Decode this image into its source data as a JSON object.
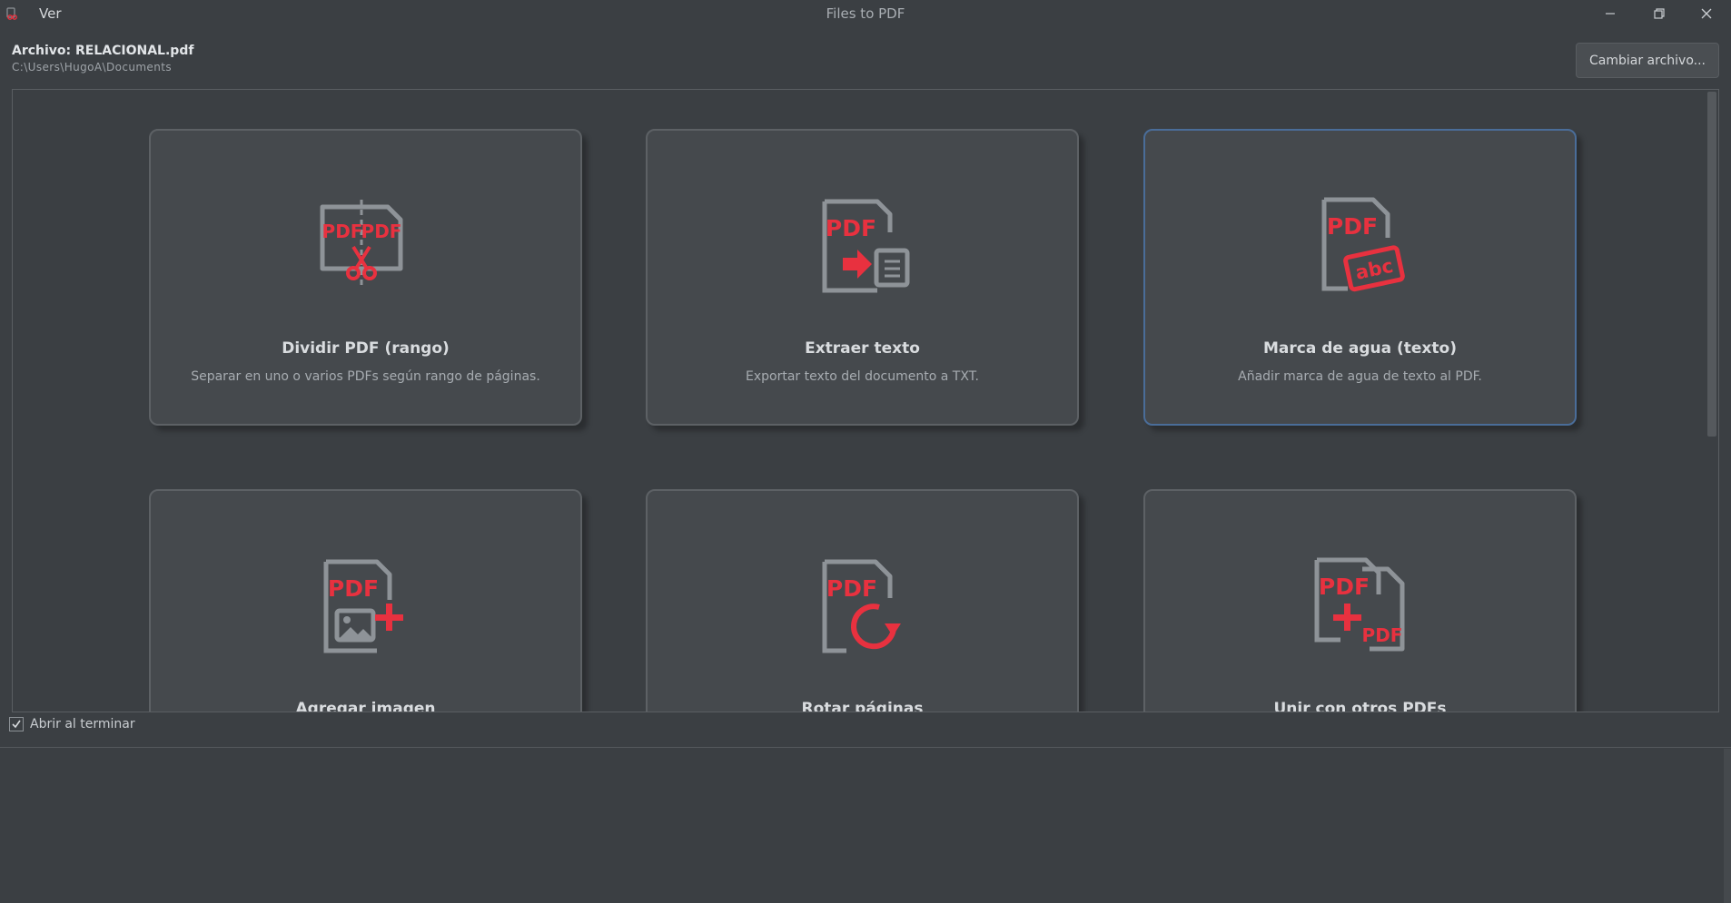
{
  "window": {
    "title": "Files to PDF",
    "menu_ver": "Ver"
  },
  "file": {
    "name_label": "Archivo: RELACIONAL.pdf",
    "path": "C:\\Users\\HugoA\\Documents",
    "change_button": "Cambiar archivo..."
  },
  "cards": [
    {
      "title": "Dividir PDF (rango)",
      "desc": "Separar en uno o varios PDFs según rango de páginas.",
      "icon": "split-pdf-icon"
    },
    {
      "title": "Extraer texto",
      "desc": "Exportar texto del documento a TXT.",
      "icon": "extract-text-icon"
    },
    {
      "title": "Marca de agua (texto)",
      "desc": "Añadir marca de agua de texto al PDF.",
      "icon": "watermark-icon"
    },
    {
      "title": "Agregar imagen",
      "desc": "",
      "icon": "add-image-icon"
    },
    {
      "title": "Rotar páginas",
      "desc": "",
      "icon": "rotate-pages-icon"
    },
    {
      "title": "Unir con otros PDFs",
      "desc": "",
      "icon": "merge-pdfs-icon"
    }
  ],
  "icon_text": {
    "pdf": "PDF",
    "abc": "abc"
  },
  "options": {
    "open_on_finish": "Abrir al terminar",
    "open_on_finish_checked": true
  },
  "colors": {
    "background": "#3b3f43",
    "card": "#45494d",
    "accent_red": "#e8313f",
    "icon_gray": "#8e9398",
    "selected_border": "#4a6d99"
  }
}
